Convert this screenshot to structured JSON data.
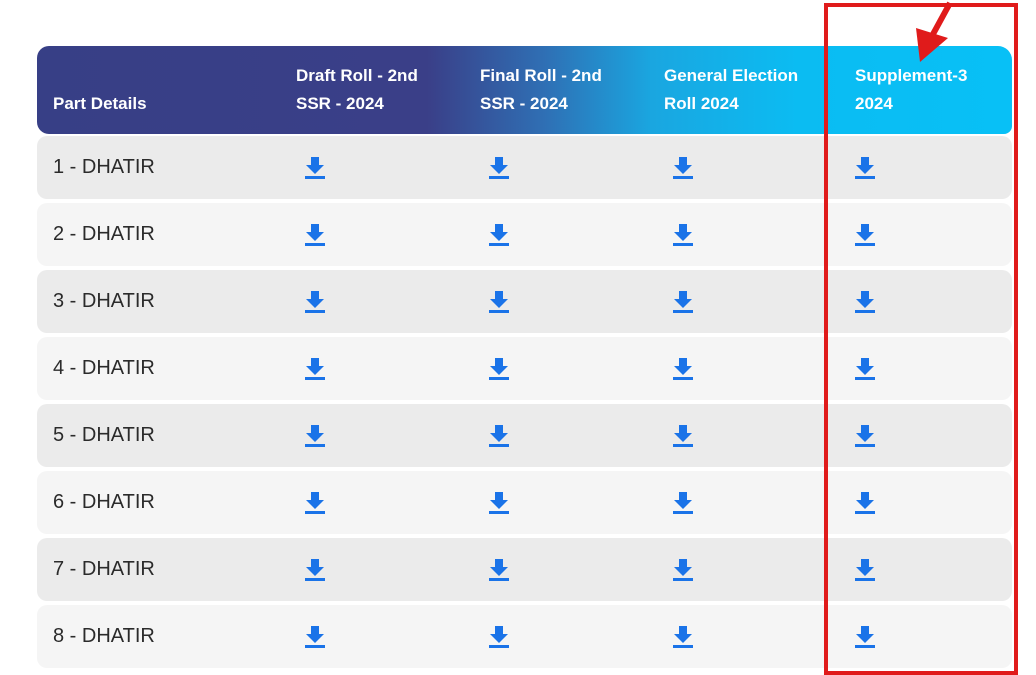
{
  "table": {
    "headers": [
      {
        "line1": "Part Details",
        "line2": ""
      },
      {
        "line1": "Draft Roll - 2nd",
        "line2": "SSR - 2024"
      },
      {
        "line1": "Final Roll - 2nd",
        "line2": "SSR - 2024"
      },
      {
        "line1": "General Election",
        "line2": "Roll 2024"
      },
      {
        "line1": "Supplement-3",
        "line2": "2024"
      }
    ],
    "rows": [
      {
        "part": "1 - DHATIR"
      },
      {
        "part": "2 - DHATIR"
      },
      {
        "part": "3 - DHATIR"
      },
      {
        "part": "4 - DHATIR"
      },
      {
        "part": "5 - DHATIR"
      },
      {
        "part": "6 - DHATIR"
      },
      {
        "part": "7 - DHATIR"
      },
      {
        "part": "8 - DHATIR"
      }
    ],
    "download_icon": "download-icon",
    "download_color": "#1a73e8"
  },
  "annotation": {
    "highlight_color": "#e01b1b",
    "highlighted_column": "Supplement-3 2024"
  }
}
